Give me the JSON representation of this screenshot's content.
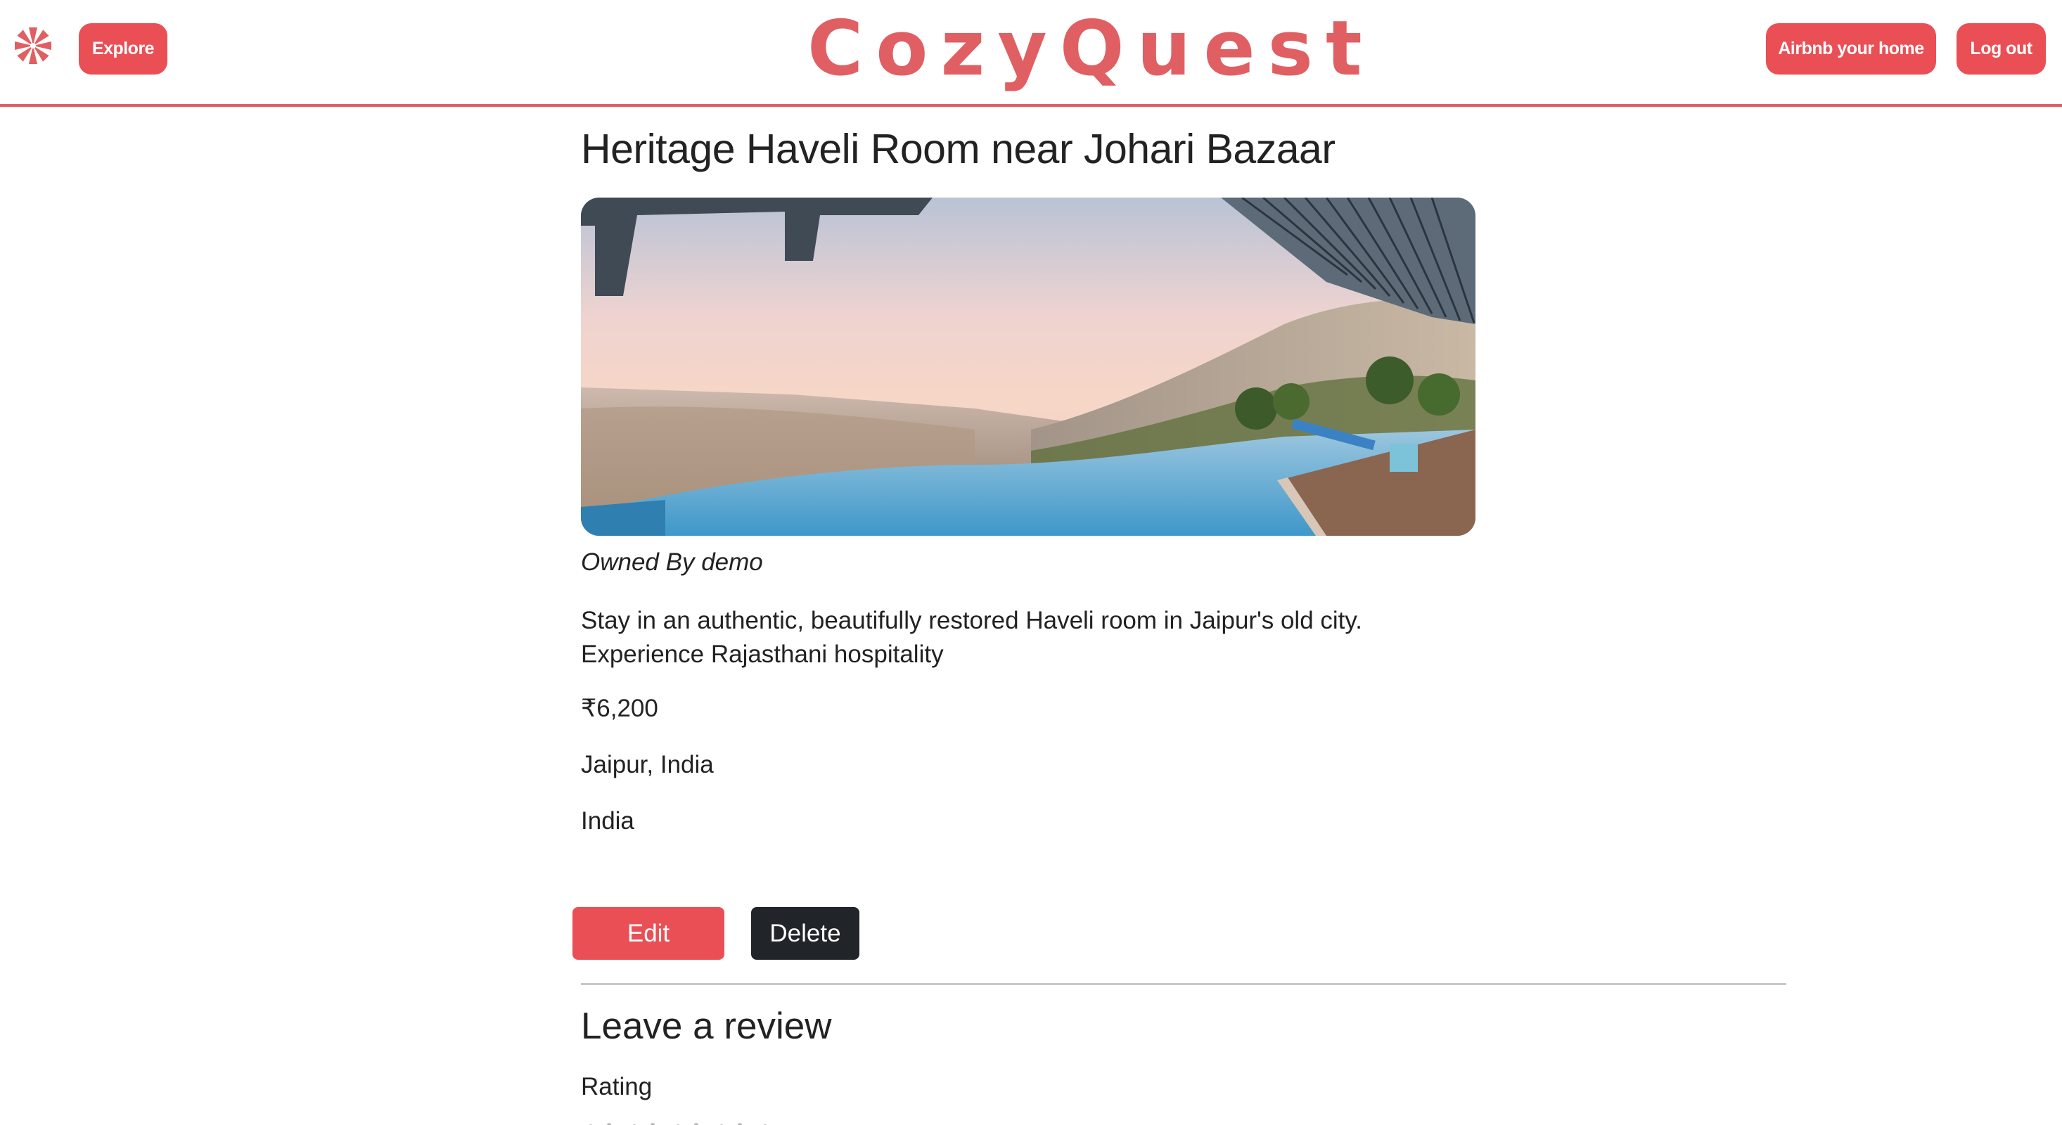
{
  "navbar": {
    "explore_label": "Explore",
    "brand": "CozyQuest",
    "airbnb_label": "Airbnb your home",
    "logout_label": "Log out",
    "logo_icon": "compass-icon",
    "accent_color": "#ea4f55"
  },
  "listing": {
    "title": "Heritage Haveli Room near Johari Bazaar",
    "image_alt": "Infinity pool overlooking a hillside town at sunset",
    "owner": "Owned By demo",
    "description": "Stay in an authentic, beautifully restored Haveli room in Jaipur's old city. Experience Rajasthani hospitality",
    "price": "₹6,200",
    "location": "Jaipur, India",
    "country": "India"
  },
  "actions": {
    "edit_label": "Edit",
    "delete_label": "Delete"
  },
  "review": {
    "heading": "Leave a review",
    "rating_label": "Rating"
  }
}
